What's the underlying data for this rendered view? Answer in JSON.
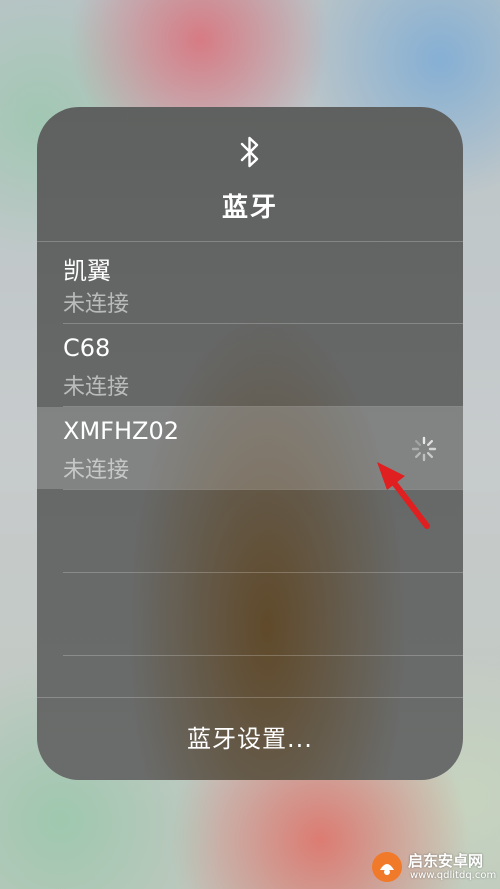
{
  "panel": {
    "icon": "bluetooth-icon",
    "title": "蓝牙",
    "footer_label": "蓝牙设置..."
  },
  "devices": [
    {
      "name": "凯翼",
      "status": "未连接",
      "connecting": false
    },
    {
      "name": "C68",
      "status": "未连接",
      "connecting": false
    },
    {
      "name": "XMFHZ02",
      "status": "未连接",
      "connecting": true
    }
  ],
  "annotation": {
    "icon": "red-arrow-icon",
    "color": "#e02020"
  },
  "watermark": {
    "title": "启东安卓网",
    "url": "www.qdlitdq.com",
    "logo": "watermark-logo-icon",
    "logo_color": "#f07a2a"
  }
}
